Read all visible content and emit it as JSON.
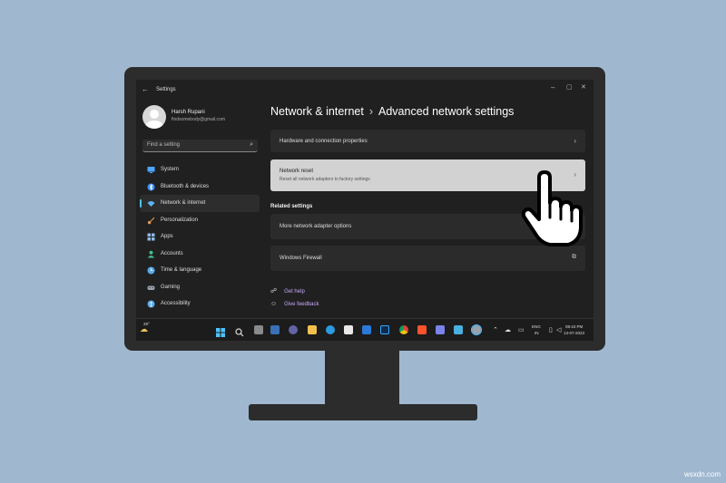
{
  "window": {
    "title": "Settings",
    "back_icon": "arrow-left-icon",
    "minimize": "–",
    "maximize": "▢",
    "close": "✕"
  },
  "profile": {
    "name": "Harsh Rupani",
    "email": "findsomebody@gmail.com"
  },
  "search": {
    "placeholder": "Find a setting"
  },
  "nav": [
    {
      "label": "System",
      "icon": "monitor-icon",
      "color": "#4ca6ff"
    },
    {
      "label": "Bluetooth & devices",
      "icon": "bluetooth-icon",
      "color": "#3a8dff"
    },
    {
      "label": "Network & internet",
      "icon": "wifi-icon",
      "color": "#5ab4ff",
      "active": true
    },
    {
      "label": "Personalization",
      "icon": "brush-icon",
      "color": "#e09a53"
    },
    {
      "label": "Apps",
      "icon": "apps-icon",
      "color": "#8fb8e8"
    },
    {
      "label": "Accounts",
      "icon": "person-icon",
      "color": "#3fbf8a"
    },
    {
      "label": "Time & language",
      "icon": "globe-clock-icon",
      "color": "#59a9e8"
    },
    {
      "label": "Gaming",
      "icon": "controller-icon",
      "color": "#9aa3ad"
    },
    {
      "label": "Accessibility",
      "icon": "accessibility-icon",
      "color": "#59a9e8"
    }
  ],
  "breadcrumb": {
    "parent": "Network & internet",
    "separator": "›",
    "current": "Advanced network settings"
  },
  "cards": {
    "hardware": {
      "label": "Hardware and connection properties"
    },
    "reset": {
      "label": "Network reset",
      "description": "Reset all network adapters to factory settings"
    },
    "related_heading": "Related settings",
    "adapter": {
      "label": "More network adapter options"
    },
    "firewall": {
      "label": "Windows Firewall"
    }
  },
  "help": {
    "get_help": "Get help",
    "give_feedback": "Give feedback"
  },
  "taskbar": {
    "weather": "28°",
    "lang_line1": "ENG",
    "lang_line2": "IN",
    "time": "08:43 PM",
    "date": "13-07-2023",
    "icons": [
      "windows-start-icon",
      "search-icon",
      "task-view-icon",
      "widgets-icon",
      "teams-icon",
      "file-explorer-icon",
      "edge-icon",
      "store-icon",
      "mail-icon",
      "photoshop-icon",
      "chrome-icon",
      "brave-icon",
      "teams-app-icon",
      "notepad-icon",
      "settings-icon"
    ]
  },
  "watermark": "wsxdn.com",
  "colors": {
    "accent": "#4cc2ff",
    "background": "#9fb8cf",
    "link": "#c8a8ff"
  }
}
